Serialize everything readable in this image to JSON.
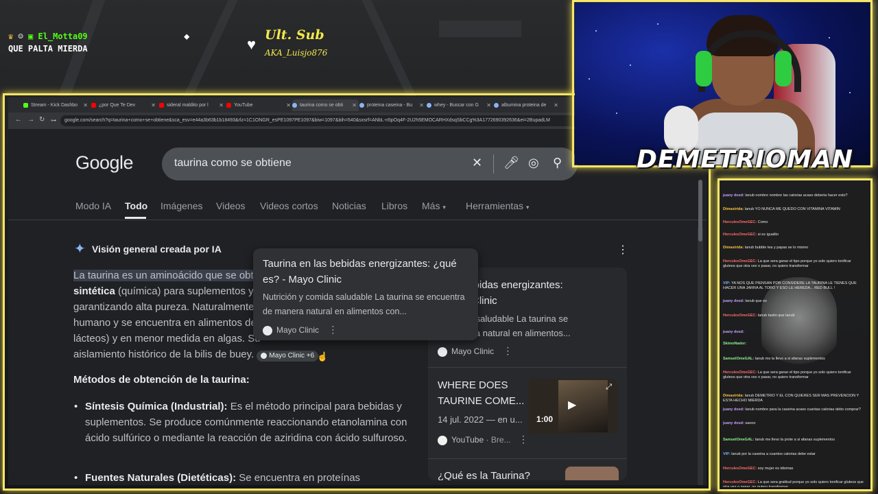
{
  "overlay": {
    "chat_user": "El_Motta09",
    "chat_message": "QUE PALTA MIERDA",
    "ult_sub_label": "Ult. Sub",
    "ult_sub_name": "AKA_Luisjo876",
    "streamer_name": "DEMETRIOMAN",
    "frame_color": "#f6e66a"
  },
  "browser": {
    "tabs": [
      {
        "label": "Stream - Kick Dashbo",
        "color": "#53fc18"
      },
      {
        "label": "¿por Que Te Dev",
        "color": "#ff0000"
      },
      {
        "label": "sideral maldito por l",
        "color": "#ff0000"
      },
      {
        "label": "YouTube",
        "color": "#ff0000"
      },
      {
        "label": "taurina como se obti",
        "color": "#8ab4f8",
        "active": true
      },
      {
        "label": "proteina caseina - Bu",
        "color": "#8ab4f8"
      },
      {
        "label": "whey - Buscar con G",
        "color": "#8ab4f8"
      },
      {
        "label": "albumina proteina de",
        "color": "#8ab4f8"
      }
    ],
    "url": "google.com/search?q=taurina+como+se+obtiene&sca_esv=e44a3b63b1b18493&rlz=1C1ONGR_esPE1097PE1097&biw=1097&bih=540&sxsrf=ANbL-n5pOq4F-2U2h5EMOCARHXdsqSbCCg%3A1772690392636&ei=2BupadLM"
  },
  "google": {
    "logo": "Google",
    "query": "taurina como se obtiene",
    "menu": [
      "Modo IA",
      "Todo",
      "Imágenes",
      "Videos",
      "Videos cortos",
      "Noticias",
      "Libros",
      "Más",
      "Herramientas"
    ],
    "ai_title": "Visión general creada por IA",
    "para_lines": [
      "La taurina es un aminoácido que se obt",
      "sintética (química) para suplementos y",
      "garantizando alta pureza. Naturalmente",
      "humano y se encuentra en alimentos de",
      "lácteos) y en menor medida en algas. Su",
      "aislamiento histórico de la bilis de buey."
    ],
    "para_bold": "sintética",
    "para_line2_rest": " (química) para suplementos y",
    "chip": "Mayo Clinic +6",
    "methods_heading": "Métodos de obtención de la taurina:",
    "bullet1_bold": "Síntesis Química (Industrial):",
    "bullet1_text": " Es el método principal para bebidas y suplementos. Se produce comúnmente reaccionando etanolamina con ácido sulfúrico o mediante la reacción de aziridina con ácido sulfuroso.",
    "bullet2_bold": "Fuentes Naturales (Dietéticas):",
    "bullet2_text": " Se encuentra en proteínas",
    "popup": {
      "title": "Taurina en las bebidas energizantes: ¿qué es? - Mayo Clinic",
      "desc": "Nutrición y comida saludable La taurina se encuentra de manera natural en alimentos con...",
      "source": "Mayo Clinic"
    },
    "side_card": {
      "title": "n las bebidas energizantes: - Mayo Clinic",
      "title_l1": "n las bebidas energizantes:",
      "title_l2": "- Mayo Clinic",
      "desc_l1": "y comida saludable La taurina se",
      "desc_l2": "de manera natural en alimentos...",
      "source": "Mayo Clinic"
    },
    "video": {
      "title_l1": "WHERE DOES",
      "title_l2": "TAURINE COME...",
      "date": "14 jul. 2022 — en u...",
      "source": "YouTube",
      "source_extra": "· Bre...",
      "duration": "1:00"
    },
    "next_title": "¿Qué es la Taurina?"
  },
  "chat": [
    {
      "user": "juany dosd:",
      "text": "lanub nombre nombre las calorias acaso deberia hacer esto?",
      "color": "#c9a0ff"
    },
    {
      "user": "Dimastrida:",
      "text": "lanub YO NUNCA ME QUEDO CON VITAMINA VITAMIN",
      "color": "#f6c343"
    },
    {
      "user": "HerculesOmeGEC:",
      "text": "Como",
      "color": "#ff6b6b"
    },
    {
      "user": "HerculesOmeGEC:",
      "text": "si es igualito",
      "color": "#ff6b6b"
    },
    {
      "user": "Dimastrida:",
      "text": "lanub bubble tea y papas se lo mismo",
      "color": "#f6c343"
    },
    {
      "user": "HerculesOmeGEC:",
      "text": "La que sera ganar el tipo porque yo solo quiero tonificar gluteos que otra vez o pasar, no quiero transformar",
      "color": "#ff6b6b"
    },
    {
      "user": "VIP:",
      "text": "YA NOS QUE PIENSAN POR CONSIDERE LA TAURINA LE TIENES QUE HACER UNA JARRA AL TORO Y ESO LE HEREDA... RED BULL !",
      "color": "#6fb7ff"
    },
    {
      "user": "juany dosd:",
      "text": "lanub que es",
      "color": "#c9a0ff"
    },
    {
      "user": "HerculesOmeGEC:",
      "text": "lanub tasito que lanub",
      "color": "#ff6b6b"
    },
    {
      "user": "juany dosd:",
      "text": "",
      "color": "#c9a0ff"
    },
    {
      "user": "SkimoNador:",
      "text": "",
      "color": "#8ef38e"
    },
    {
      "user": "SamuelOmeGAL:",
      "text": "lanub me la llevo a si afanas suplementos",
      "color": "#8ef38e"
    },
    {
      "user": "HerculesOmeGEC:",
      "text": "La que sera ganar el tipo porque yo solo quiero tonificar gluteos que otra vez o pasar, no quiero transformar",
      "color": "#ff6b6b"
    },
    {
      "user": "Dimastrida:",
      "text": "lanub DEMETRIO Y EL CON QUIERES SER MAS PREVENCION Y ESTA HECHO MIERDA",
      "color": "#f6c343"
    },
    {
      "user": "juany dosd:",
      "text": "lanub nombre para la caseina acaso cuantas calorias debo comprar?",
      "color": "#c9a0ff"
    },
    {
      "user": "juany dosd:",
      "text": "saooo",
      "color": "#c9a0ff"
    },
    {
      "user": "SamuelOmeGAL:",
      "text": "lanub me llevo la prote a si afanas suplementos",
      "color": "#8ef38e"
    },
    {
      "user": "VIP:",
      "text": "lanub por la caseina a cuantos calorias debe estar",
      "color": "#6fb7ff"
    },
    {
      "user": "HerculesOmeGEC:",
      "text": "soy mujer es idiomas",
      "color": "#ff6b6b"
    },
    {
      "user": "HerculesOmeGEC:",
      "text": "La que sera gratitud porque yo solo quiero tonificar gluteos que otra vez o pasar, no quiero transformar",
      "color": "#ff6b6b"
    }
  ]
}
